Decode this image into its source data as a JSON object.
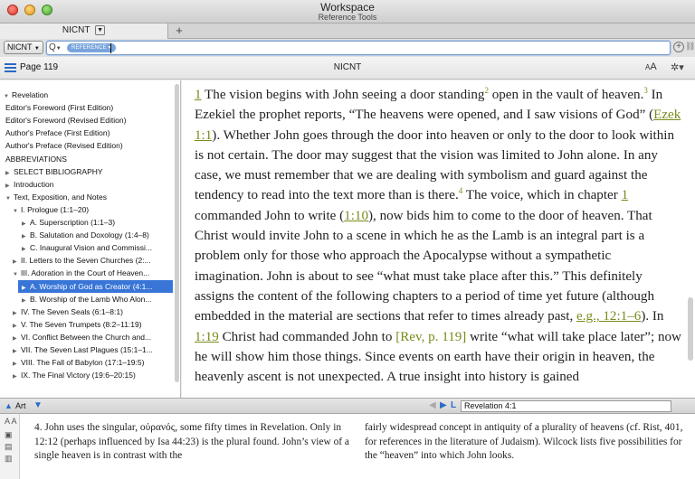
{
  "window": {
    "title": "Workspace",
    "subtitle": "Reference Tools"
  },
  "tab": {
    "label": "NICNT",
    "add_label": "+"
  },
  "search": {
    "resource_button": "NICNT",
    "query_icon": "Q",
    "pill": "REFERENCE"
  },
  "resource_header": {
    "page": "Page 119",
    "name": "NICNT",
    "font_big": "A",
    "font_small": "A"
  },
  "toc": [
    {
      "label": "Revelation",
      "indent": 0,
      "tri": "down"
    },
    {
      "label": "Editor's Foreword (First Edition)",
      "indent": 1,
      "tri": ""
    },
    {
      "label": "Editor's Foreword (Revised Edition)",
      "indent": 1,
      "tri": ""
    },
    {
      "label": "Author's Preface (First Edition)",
      "indent": 1,
      "tri": ""
    },
    {
      "label": "Author's Preface (Revised Edition)",
      "indent": 1,
      "tri": ""
    },
    {
      "label": "ABBREVIATIONS",
      "indent": 1,
      "tri": ""
    },
    {
      "label": "SELECT BIBLIOGRAPHY",
      "indent": 1,
      "tri": "right"
    },
    {
      "label": "Introduction",
      "indent": 1,
      "tri": "right"
    },
    {
      "label": "Text, Exposition, and Notes",
      "indent": 1,
      "tri": "down"
    },
    {
      "label": "I. Prologue (1:1–20)",
      "indent": 2,
      "tri": "down"
    },
    {
      "label": "A. Superscription (1:1–3)",
      "indent": 3,
      "tri": "right"
    },
    {
      "label": "B. Salutation and Doxology (1:4–8)",
      "indent": 3,
      "tri": "right"
    },
    {
      "label": "C. Inaugural Vision and Commissi...",
      "indent": 3,
      "tri": "right"
    },
    {
      "label": "II. Letters to the Seven Churches (2:...",
      "indent": 2,
      "tri": "right"
    },
    {
      "label": "III. Adoration in the Court of Heaven...",
      "indent": 2,
      "tri": "down"
    },
    {
      "label": "A. Worship of God as Creator (4:1...",
      "indent": 3,
      "tri": "right",
      "selected": true
    },
    {
      "label": "B. Worship of the Lamb Who Alon...",
      "indent": 3,
      "tri": "right"
    },
    {
      "label": "IV. The Seven Seals (6:1–8:1)",
      "indent": 2,
      "tri": "right"
    },
    {
      "label": "V. The Seven Trumpets (8:2–11:19)",
      "indent": 2,
      "tri": "right"
    },
    {
      "label": "VI. Conflict Between the Church and...",
      "indent": 2,
      "tri": "right"
    },
    {
      "label": "VII. The Seven Last Plagues (15:1–1...",
      "indent": 2,
      "tri": "right"
    },
    {
      "label": "VIII. The Fall of Babylon (17:1–19:5)",
      "indent": 2,
      "tri": "right"
    },
    {
      "label": "IX. The Final Victory (19:6–20:15)",
      "indent": 2,
      "tri": "right"
    }
  ],
  "main": {
    "t1": "1",
    "t2": " The vision begins with John seeing a door standing",
    "t3": "2",
    "t4": " open in the vault of heaven.",
    "t5": "3",
    "t6": " In Ezekiel the prophet reports, “The heavens were opened, and I saw visions of God” (",
    "t7": "Ezek 1:1",
    "t8": "). Whether John goes through the door into heaven or only to the door to look within is not certain. The door may suggest that the vision was limited to John alone. In any case, we must remember that we are dealing with symbolism and guard against the tendency to read into the text more than is there.",
    "t9": "4",
    "t10": " The voice, which in chapter ",
    "t11": "1",
    "t12": " commanded John to write (",
    "t13": "1:10",
    "t14": "), now bids him to come to the door of heaven. That Christ would invite John to a scene in which he as the Lamb is an integral part is a problem only for those who approach the Apocalypse without a sympathetic imagination. John is about to see “what must take place after this.” This definitely assigns the content of the following chapters to a period of time yet future (although embedded in the material are sections that refer to times already past, ",
    "t15": "e.g., 12:1–6",
    "t16": "). In ",
    "t17": "1:19",
    "t18": " Christ had commanded John to ",
    "t19": "[",
    "t20": "Rev, p. 119",
    "t21": "]",
    "t22": " write “what will take place later”; now he will show him those things. Since events on earth have their origin in heaven, the heavenly ascent is not unexpected. A true insight into history is gained"
  },
  "status": {
    "panel": "Art",
    "reference": "Revelation 4:1"
  },
  "notes": {
    "col1": "4. John uses the singular, οὐρανός, some fifty times in Revelation. Only in 12:12 (perhaps influenced by Isa 44:23) is the plural found. John’s view of a single heaven is in contrast with the",
    "col2": "fairly widespread concept in antiquity of a plurality of heavens (cf. Rist, 401, for references in the literature of Judaism). Wilcock lists five possibilities for the “heaven” into which John looks.",
    "tool_font": "A A"
  }
}
